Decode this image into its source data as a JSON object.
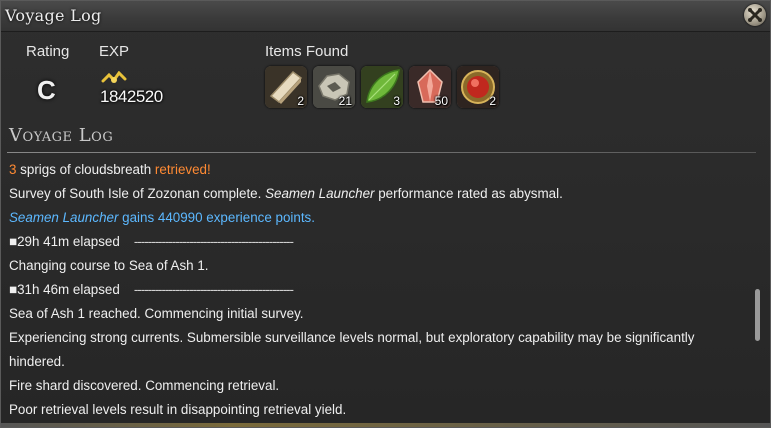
{
  "window": {
    "title": "Voyage Log"
  },
  "summary": {
    "rating_label": "Rating",
    "rating_value": "C",
    "exp_label": "EXP",
    "exp_value": "1842520",
    "items_label": "Items Found"
  },
  "items": [
    {
      "icon": "wood-plank-icon",
      "qty": "2"
    },
    {
      "icon": "ore-chunk-icon",
      "qty": "21"
    },
    {
      "icon": "cloudsbreath-leaf-icon",
      "qty": "3"
    },
    {
      "icon": "fire-shard-icon",
      "qty": "50"
    },
    {
      "icon": "red-orb-icon",
      "qty": "2"
    }
  ],
  "log": {
    "section_title": "Voyage Log",
    "lines": {
      "l1_count": "3",
      "l1_text": " sprigs of cloudsbreath ",
      "l1_status": "retrieved!",
      "l2_a": "Survey of South Isle of Zozonan complete. ",
      "l2_sub": "Seamen Launcher",
      "l2_b": " performance rated as abysmal.",
      "l3_sub": "Seamen Launcher",
      "l3_b": " gains 440990  experience points.",
      "l4_time": "29h 41m elapsed",
      "l4_dash": "----------------------------------------------",
      "l5": "Changing course to Sea of Ash 1.",
      "l6_time": "31h 46m elapsed",
      "l6_dash": "----------------------------------------------",
      "l7": "Sea of Ash 1 reached. Commencing initial survey.",
      "l8": "Experiencing strong currents. Submersible surveillance levels normal, but exploratory capability may be significantly",
      "l9": "hindered.",
      "l10": "Fire shard discovered. Commencing retrieval.",
      "l11": "Poor retrieval levels result in disappointing retrieval yield."
    }
  },
  "colors": {
    "accent_orange": "#ff8a33",
    "accent_blue": "#5cb8ff"
  }
}
